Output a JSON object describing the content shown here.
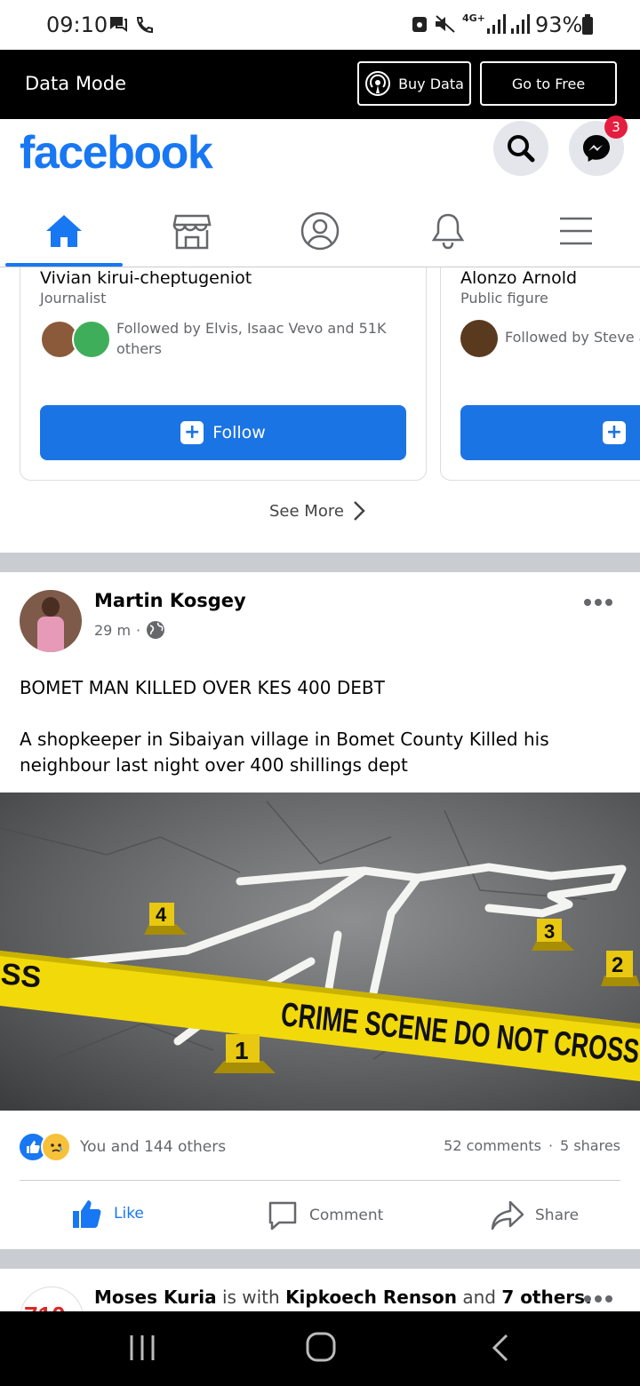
{
  "status_bar": {
    "time": "09:10",
    "network": "4G+",
    "battery": "93%"
  },
  "data_mode": {
    "label": "Data Mode",
    "buy_data": "Buy Data",
    "go_free": "Go to Free"
  },
  "header": {
    "logo": "facebook",
    "messenger_badge": "3"
  },
  "nav": {
    "active": "home",
    "items": [
      "home",
      "marketplace",
      "profile",
      "notifications",
      "menu"
    ]
  },
  "suggestions": {
    "cards": [
      {
        "name": "Vivian kirui-cheptugeniot",
        "subtitle": "Journalist",
        "followed_by": "Followed by Elvis, Isaac Vevo and 51K others",
        "button": "Follow"
      },
      {
        "name": "Alonzo Arnold",
        "subtitle": "Public figure",
        "followed_by": "Followed by Steve ar",
        "button": "Follow"
      }
    ],
    "see_more": "See More"
  },
  "post": {
    "author": "Martin Kosgey",
    "time": "29 m",
    "headline": "BOMET MAN KILLED OVER KES 400 DEBT",
    "body": "A shopkeeper in Sibaiyan village in Bomet County Killed his neighbour last night over 400 shillings dept",
    "image": {
      "tape_left": "SS",
      "tape_text": "CRIME SCENE   DO NOT CROSS",
      "markers": [
        "4",
        "3",
        "2",
        "1"
      ]
    },
    "reactions": "You and 144 others",
    "comments": "52 comments",
    "shares": "5 shares",
    "actions": {
      "like": "Like",
      "comment": "Comment",
      "share": "Share"
    }
  },
  "next_post": {
    "author": "Moses Kuria",
    "with_text": "is with",
    "tagged": "Kipkoech Renson",
    "and_text": "and",
    "others": "7 others."
  },
  "colors": {
    "brand": "#1877f2",
    "follow_button": "#1b74e4",
    "tape": "#f2d90a"
  }
}
